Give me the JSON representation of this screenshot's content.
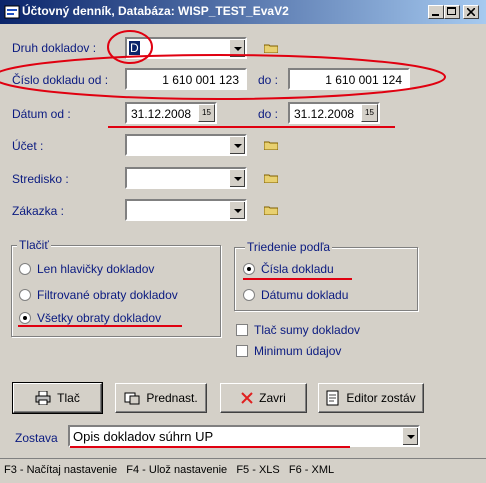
{
  "window": {
    "title": "Účtovný denník, Databáza: WISP_TEST_EvaV2"
  },
  "form": {
    "druh_label": "Druh dokladov :",
    "druh_value": "D",
    "cislo_label": "Číslo dokladu od :",
    "cislo_od": "1 610 001 123",
    "cislo_do_label": "do :",
    "cislo_do": "1 610 001 124",
    "datum_label": "Dátum od :",
    "datum_od": "31.12.2008",
    "datum_do_label": "do :",
    "datum_do": "31.12.2008",
    "ucet_label": "Účet :",
    "stredisko_label": "Stredisko :",
    "zakazka_label": "Zákazka :"
  },
  "tlac_group": {
    "title": "Tlačiť",
    "options": [
      "Len hlavičky dokladov",
      "Filtrované obraty dokladov",
      "Všetky obraty dokladov"
    ],
    "selected": 2
  },
  "triedenie_group": {
    "title": "Triedenie podľa",
    "options": [
      "Čísla dokladu",
      "Dátumu dokladu"
    ],
    "selected": 0
  },
  "checkboxes": {
    "tlac_sumy": "Tlač sumy dokladov",
    "minimum": "Minimum údajov"
  },
  "buttons": {
    "tlac": "Tlač",
    "prednast": "Prednast.",
    "zavri": "Zavri",
    "editor": "Editor zostáv"
  },
  "zostava": {
    "label": "Zostava",
    "value": "Opis dokladov súhrn UP"
  },
  "status_bar": "F3 - Načítaj nastavenie   F4 - Ulož nastavenie   F5 - XLS   F6 - XML"
}
